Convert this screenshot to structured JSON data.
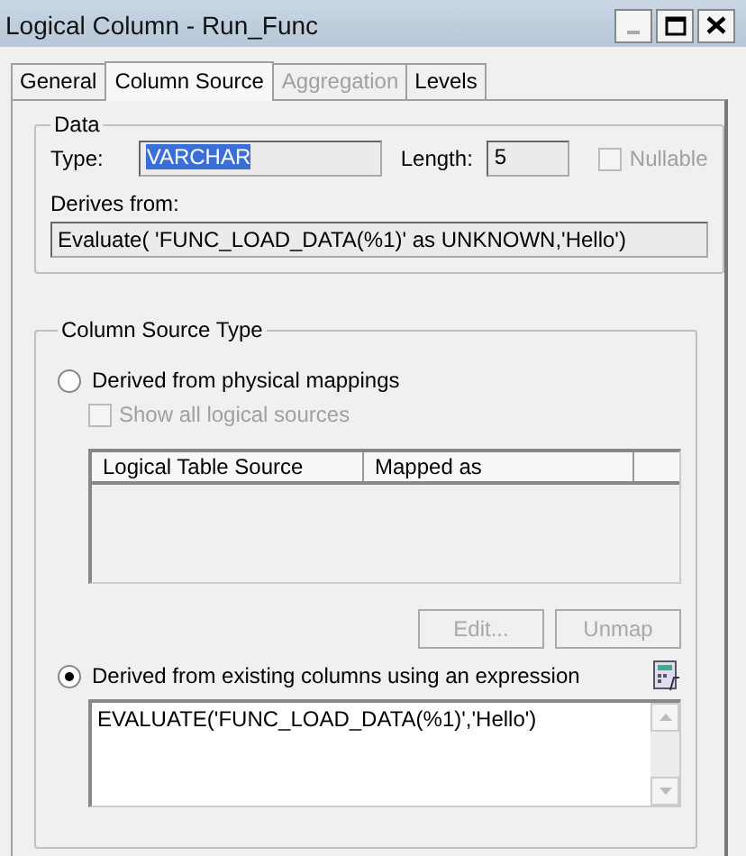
{
  "window": {
    "title": "Logical Column - Run_Func"
  },
  "tabs": [
    {
      "label": "General",
      "selected": false,
      "disabled": false
    },
    {
      "label": "Column Source",
      "selected": true,
      "disabled": false
    },
    {
      "label": "Aggregation",
      "selected": false,
      "disabled": true
    },
    {
      "label": "Levels",
      "selected": false,
      "disabled": false
    }
  ],
  "data": {
    "legend": "Data",
    "type_label": "Type:",
    "type_value": "VARCHAR",
    "length_label": "Length:",
    "length_value": "5",
    "nullable": {
      "label": "Nullable",
      "checked": false,
      "disabled": true
    },
    "derives_label": "Derives from:",
    "derives_value": "Evaluate( 'FUNC_LOAD_DATA(%1)' as UNKNOWN,'Hello')"
  },
  "source_type": {
    "legend": "Column Source Type",
    "physical": {
      "label": "Derived from physical mappings",
      "selected": false
    },
    "show_all": {
      "label": "Show all logical sources",
      "checked": false,
      "disabled": true
    },
    "table": {
      "columns": [
        "Logical Table Source",
        "Mapped as"
      ]
    },
    "buttons": [
      {
        "label": "Edit...",
        "disabled": true
      },
      {
        "label": "Unmap",
        "disabled": true
      }
    ],
    "expression": {
      "label": "Derived from existing columns using an expression",
      "selected": true
    },
    "expression_value": "EVALUATE('FUNC_LOAD_DATA(%1)','Hello')"
  }
}
